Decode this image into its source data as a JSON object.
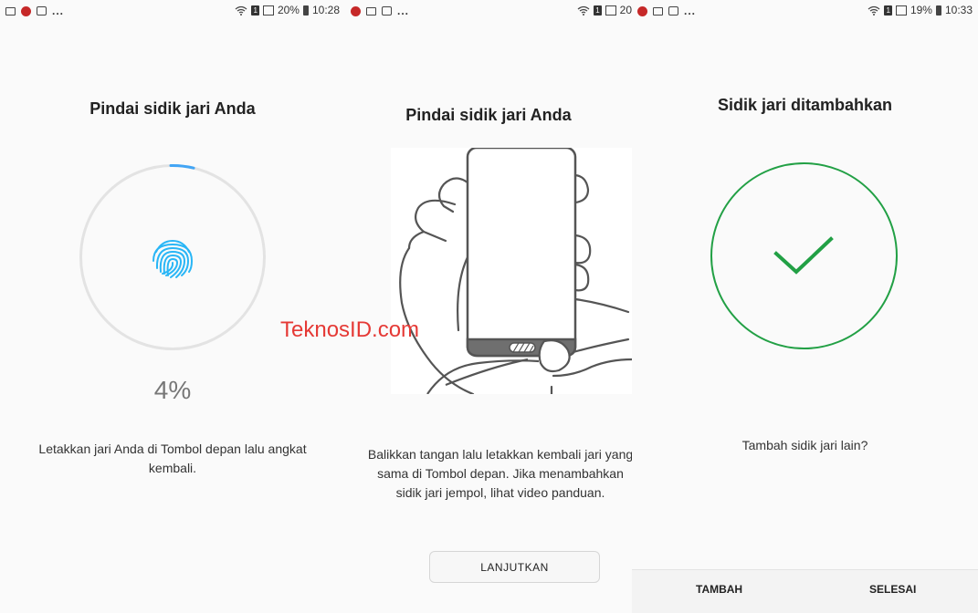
{
  "screen1": {
    "status": {
      "battery": "20%",
      "time": "10:28",
      "sim": "1",
      "dots": "..."
    },
    "title": "Pindai sidik jari Anda",
    "progress": 0.04,
    "percent": "4%",
    "description": "Letakkan jari Anda di Tombol depan lalu angkat kembali.",
    "colors": {
      "progress_arc": "#42a5f5",
      "ring": "#e3e3e3",
      "fingerprint": "#29b6f6"
    }
  },
  "watermark": "TeknosID.com",
  "screen2": {
    "status": {
      "partial": "20",
      "sim": "1",
      "dots": "..."
    },
    "title": "Pindai sidik jari Anda",
    "description": "Balikkan tangan lalu letakkan kembali jari yang sama di Tombol depan. Jika menambahkan sidik jari jempol, lihat video panduan.",
    "continue_label": "LANJUTKAN"
  },
  "screen3": {
    "status": {
      "battery": "19%",
      "time": "10:33",
      "sim": "1",
      "dots": "..."
    },
    "title": "Sidik jari ditambahkan",
    "prompt": "Tambah sidik jari lain?",
    "add_label": "TAMBAH",
    "done_label": "SELESAI",
    "colors": {
      "check": "#22a045"
    }
  }
}
